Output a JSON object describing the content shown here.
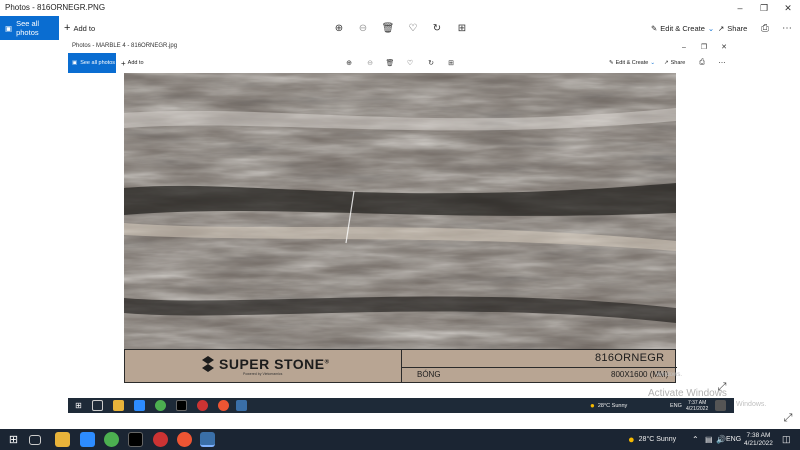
{
  "app": {
    "window_title": "Photos - 816ORNEGR.PNG",
    "see_all_label": "See all photos",
    "add_to_label": "Add to",
    "edit_create_label": "Edit & Create",
    "share_label": "Share"
  },
  "inner_window": {
    "window_title": "Photos - MARBLE 4 - 816ORNEGR.jpg",
    "see_all_label": "See all photos",
    "add_to_label": "Add to",
    "edit_create_label": "Edit & Create",
    "share_label": "Share"
  },
  "product_label": {
    "brand": "SUPER STONE",
    "brand_mark": "®",
    "brand_sub": "Powered by Vietceramics",
    "code": "816ORNEGR",
    "finish": "BÓNG",
    "size": "800X1600 (MM)"
  },
  "watermark": {
    "line1": "Activate Windows",
    "line2": "Windows.",
    "line3": "Windows."
  },
  "inner_taskbar": {
    "weather": "28°C  Sunny",
    "lang": "ENG",
    "time": "7:37 AM",
    "date": "4/21/2022"
  },
  "taskbar": {
    "weather": "28°C  Sunny",
    "lang": "ENG",
    "time": "7:38 AM",
    "date": "4/21/2022"
  },
  "colors": {
    "accent": "#0a6dd1",
    "label_bg": "#b8a593",
    "taskbar": "#1b2533"
  }
}
